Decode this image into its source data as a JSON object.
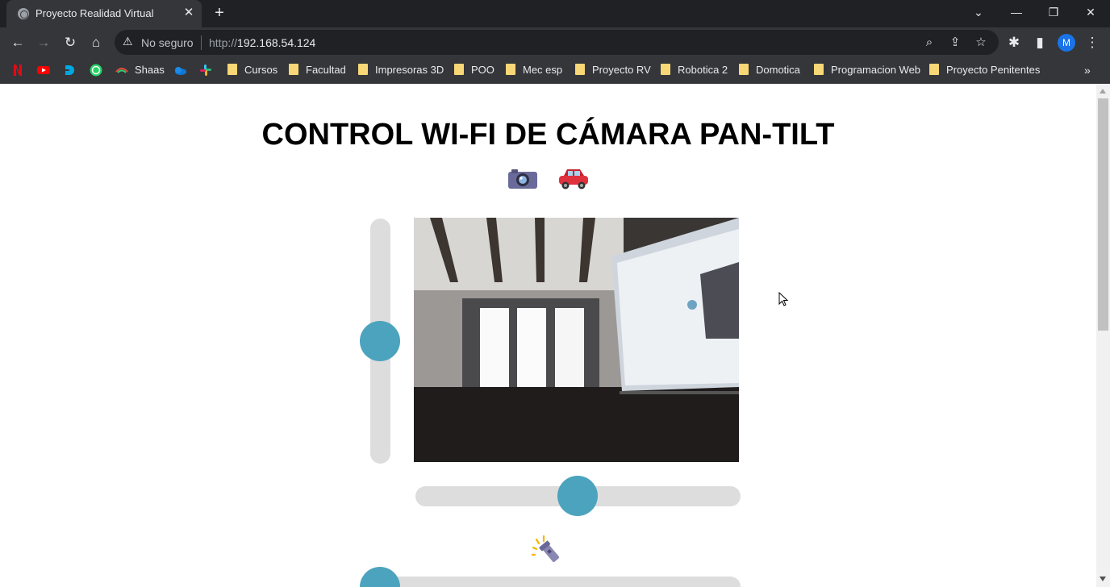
{
  "browser": {
    "tab": {
      "title": "Proyecto Realidad Virtual"
    },
    "omnibox": {
      "security_label": "No seguro",
      "url_scheme": "http://",
      "url_host": "192.168.54.124"
    },
    "profile_initial": "M",
    "bookmarks": [
      {
        "label": "Shaas",
        "type": "site"
      },
      {
        "label": "Cursos",
        "type": "folder"
      },
      {
        "label": "Facultad",
        "type": "folder"
      },
      {
        "label": "Impresoras 3D",
        "type": "folder"
      },
      {
        "label": "POO",
        "type": "folder"
      },
      {
        "label": "Mec esp",
        "type": "folder"
      },
      {
        "label": "Proyecto RV",
        "type": "folder"
      },
      {
        "label": "Robotica 2",
        "type": "folder"
      },
      {
        "label": "Domotica",
        "type": "folder"
      },
      {
        "label": "Programacion Web",
        "type": "folder"
      },
      {
        "label": "Proyecto Penitentes",
        "type": "folder"
      }
    ]
  },
  "page": {
    "title": "CONTROL WI-FI DE CÁMARA PAN-TILT",
    "icons": [
      "camera-icon",
      "car-icon",
      "flashlight-icon"
    ],
    "controls": {
      "tilt_slider_value_fraction": 0.5,
      "pan_slider_value_fraction": 0.5,
      "light_slider_value_fraction": 0.0
    },
    "colors": {
      "slider_knob": "#4ca3bd",
      "slider_track": "#dddddd"
    }
  }
}
